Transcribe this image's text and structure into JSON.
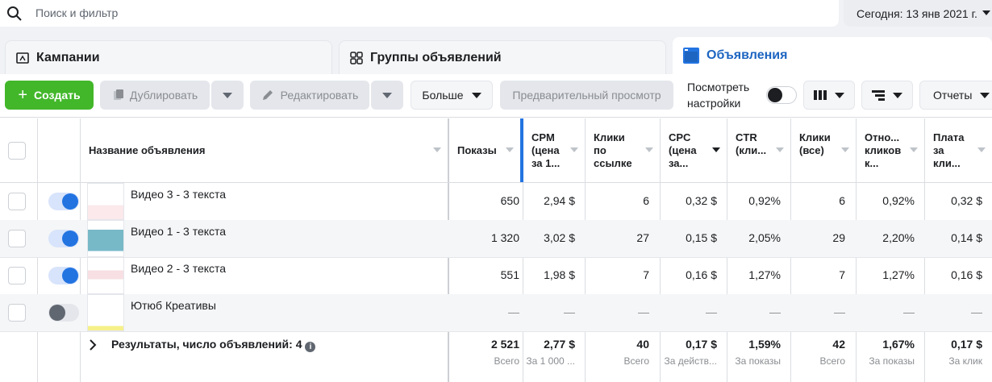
{
  "search": {
    "placeholder": "Поиск и фильтр"
  },
  "date_range": {
    "label": "Сегодня: 13 янв 2021 г."
  },
  "tabs": [
    {
      "label": "Кампании",
      "icon": "folder-icon"
    },
    {
      "label": "Группы объявлений",
      "icon": "grid-icon"
    },
    {
      "label": "Объявления",
      "icon": "ad-window-icon",
      "active": true
    }
  ],
  "toolbar": {
    "create": "Создать",
    "duplicate": "Дублировать",
    "edit": "Редактировать",
    "more": "Больше",
    "preview": "Предварительный просмотр",
    "view_settings_line1": "Посмотреть",
    "view_settings_line2": "настройки",
    "reports": "Отчеты"
  },
  "colors": {
    "create_green": "#42b72a",
    "active_blue": "#2374e1",
    "tab_active_text": "#1d65c1"
  },
  "table": {
    "headers": {
      "name": "Название объявления",
      "impressions": "Показы",
      "cpm": [
        "CPM",
        "(цена",
        "за 1..."
      ],
      "link_clicks": [
        "Клики",
        "по",
        "ссылке"
      ],
      "cpc": [
        "CPC",
        "(цена",
        "за..."
      ],
      "ctr": [
        "CTR",
        "(кли..."
      ],
      "clicks_all": [
        "Клики",
        "(все)"
      ],
      "rel_clicks": [
        "Отно...",
        "кликов",
        "к..."
      ],
      "cost_per": [
        "Плата",
        "за",
        "кли..."
      ]
    },
    "rows": [
      {
        "name": "Видео 3 - 3 текста",
        "impressions": "650",
        "cpm": "2,94 $",
        "link_clicks": "6",
        "cpc": "0,32 $",
        "ctr": "0,92%",
        "clicks_all": "6",
        "rel_clicks": "0,92%",
        "cost_per": "0,32 $",
        "active": true
      },
      {
        "name": "Видео 1 - 3 текста",
        "impressions": "1 320",
        "cpm": "3,02 $",
        "link_clicks": "27",
        "cpc": "0,15 $",
        "ctr": "2,05%",
        "clicks_all": "29",
        "rel_clicks": "2,20%",
        "cost_per": "0,14 $",
        "active": true
      },
      {
        "name": "Видео 2 - 3 текста",
        "impressions": "551",
        "cpm": "1,98 $",
        "link_clicks": "7",
        "cpc": "0,16 $",
        "ctr": "1,27%",
        "clicks_all": "7",
        "rel_clicks": "1,27%",
        "cost_per": "0,16 $",
        "active": true
      },
      {
        "name": "Ютюб Креативы",
        "impressions": "—",
        "cpm": "—",
        "link_clicks": "—",
        "cpc": "—",
        "ctr": "—",
        "clicks_all": "—",
        "rel_clicks": "—",
        "cost_per": "—",
        "active": false
      }
    ],
    "footer": {
      "label": "Результаты, число объявлений: 4",
      "impressions": {
        "value": "2 521",
        "sub": "Всего"
      },
      "cpm": {
        "value": "2,77 $",
        "sub": "За 1 000 ..."
      },
      "link_clicks": {
        "value": "40",
        "sub": "Всего"
      },
      "cpc": {
        "value": "0,17 $",
        "sub": "За действ..."
      },
      "ctr": {
        "value": "1,59%",
        "sub": "За показы"
      },
      "clicks_all": {
        "value": "42",
        "sub": "Всего"
      },
      "rel_clicks": {
        "value": "1,67%",
        "sub": "За показы"
      },
      "cost_per": {
        "value": "0,17 $",
        "sub": "За клик"
      }
    }
  }
}
